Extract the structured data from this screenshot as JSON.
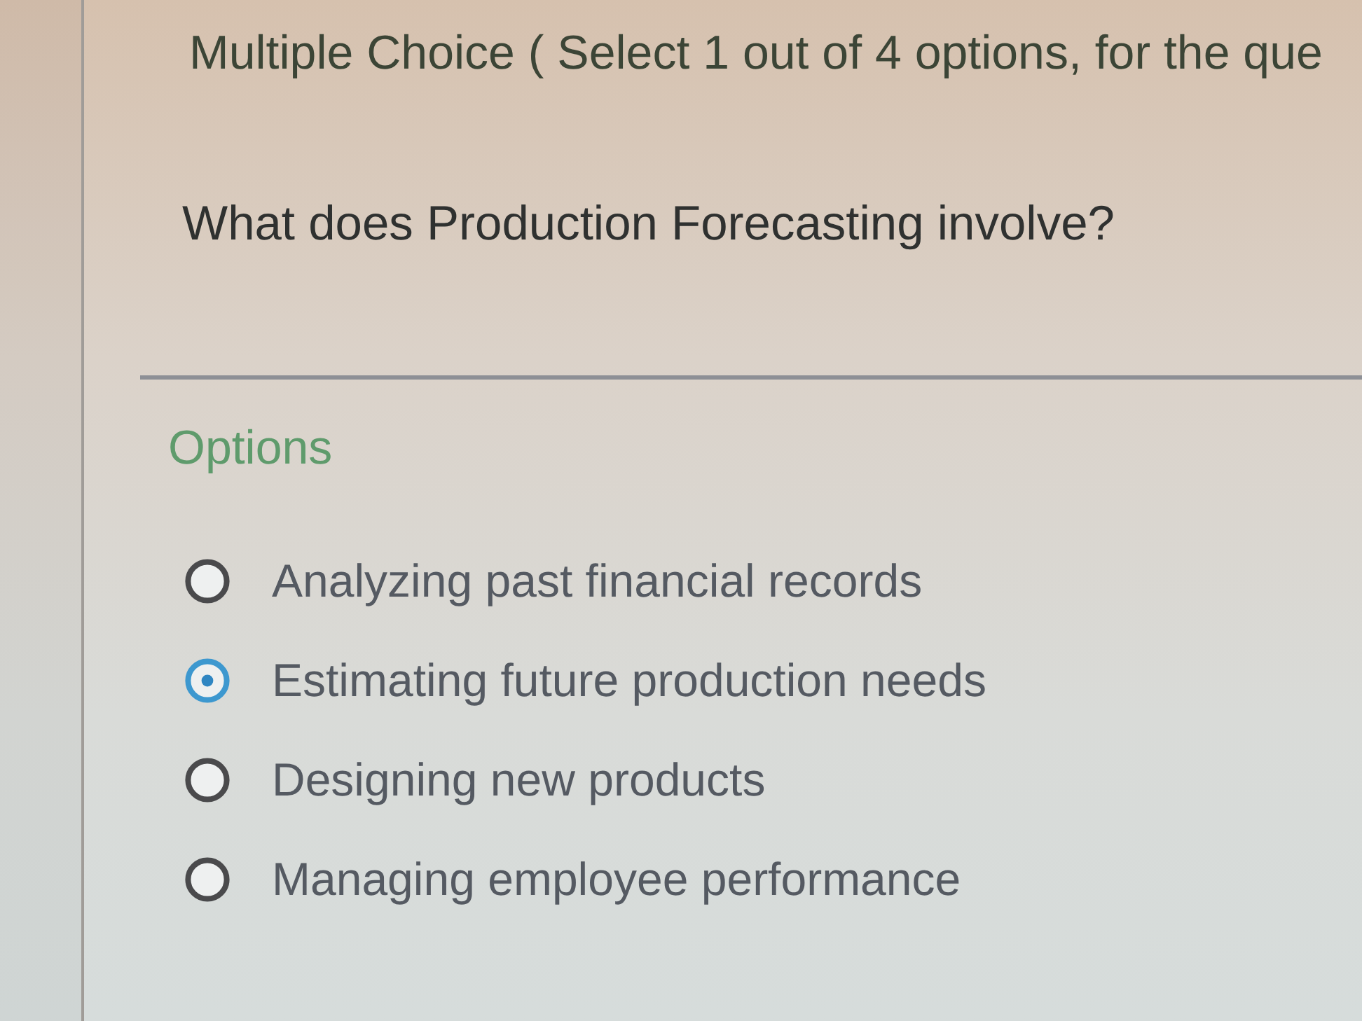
{
  "header": {
    "text": "Multiple Choice ( Select 1 out of 4 options, for the que"
  },
  "question": {
    "text": "What does Production Forecasting involve?"
  },
  "options_heading": "Options",
  "options": [
    {
      "label": "Analyzing past financial records",
      "selected": false
    },
    {
      "label": "Estimating future production needs",
      "selected": true
    },
    {
      "label": "Designing new products",
      "selected": false
    },
    {
      "label": "Managing employee performance",
      "selected": false
    }
  ]
}
